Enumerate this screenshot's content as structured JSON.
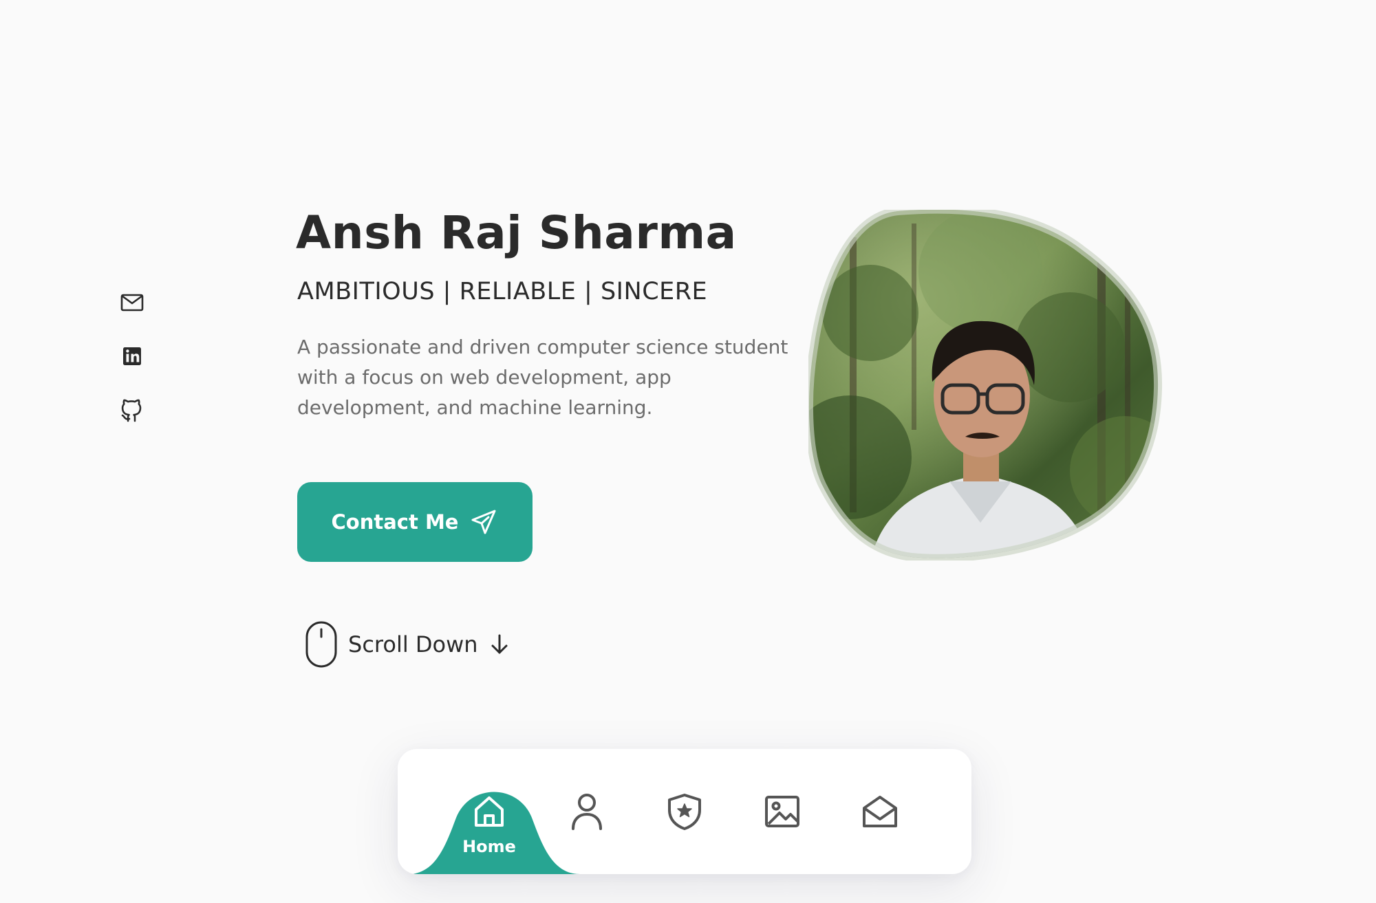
{
  "hero": {
    "name": "Ansh Raj Sharma",
    "tagline": "AMBITIOUS | RELIABLE | SINCERE",
    "description": "A passionate and driven computer science student with a focus on web development, app development, and machine learning.",
    "contact_label": "Contact Me",
    "scroll_label": "Scroll Down"
  },
  "social": [
    {
      "icon": "mail-icon"
    },
    {
      "icon": "linkedin-icon"
    },
    {
      "icon": "github-icon"
    }
  ],
  "profile": {
    "icon": "profile-photo"
  },
  "nav": {
    "items": [
      {
        "icon": "home-icon",
        "label": "Home",
        "active": true
      },
      {
        "icon": "user-icon",
        "label": "",
        "active": false
      },
      {
        "icon": "shield-star-icon",
        "label": "",
        "active": false
      },
      {
        "icon": "image-icon",
        "label": "",
        "active": false
      },
      {
        "icon": "mail-open-icon",
        "label": "",
        "active": false
      }
    ]
  },
  "colors": {
    "accent": "#27a592",
    "background": "#fafafa",
    "text": "#2a2a2a",
    "muted": "#6b6b6b"
  }
}
